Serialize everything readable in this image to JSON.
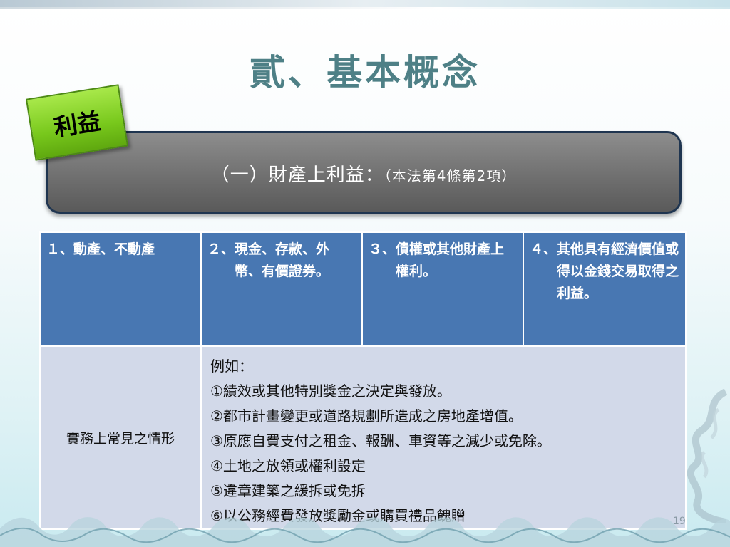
{
  "title": "貳、基本概念",
  "tag": "利益",
  "banner": {
    "main": "（一）財產上利益：",
    "note": "（本法第4條第2項）"
  },
  "table": {
    "headers": [
      {
        "num": "１、",
        "text": "動產、不動產"
      },
      {
        "num": "２、",
        "text": "現金、存款、外幣、有價證券。"
      },
      {
        "num": "３、",
        "text": "債權或其他財產上權利。"
      },
      {
        "num": "４、",
        "text": "其他具有經濟價值或得以金錢交易取得之利益。"
      }
    ],
    "row_label": "實務上常見之情形",
    "examples_intro": "例如：",
    "examples": [
      "①績效或其他特別獎金之決定與發放。",
      "②都市計畫變更或道路規劃所造成之房地產增值。",
      "③原應自費支付之租金、報酬、車資等之減少或免除。",
      "④土地之放領或權利設定",
      "⑤違章建築之緩拆或免拆",
      "⑥以公務經費發放獎勵金或購買禮品餽贈"
    ]
  },
  "page_number": "19",
  "colors": {
    "title": "#4e8086",
    "header_fill": "#4877b2",
    "body_fill": "#d2d9e9",
    "tag_fill": "#78c81c",
    "banner_fill": "#707070"
  }
}
